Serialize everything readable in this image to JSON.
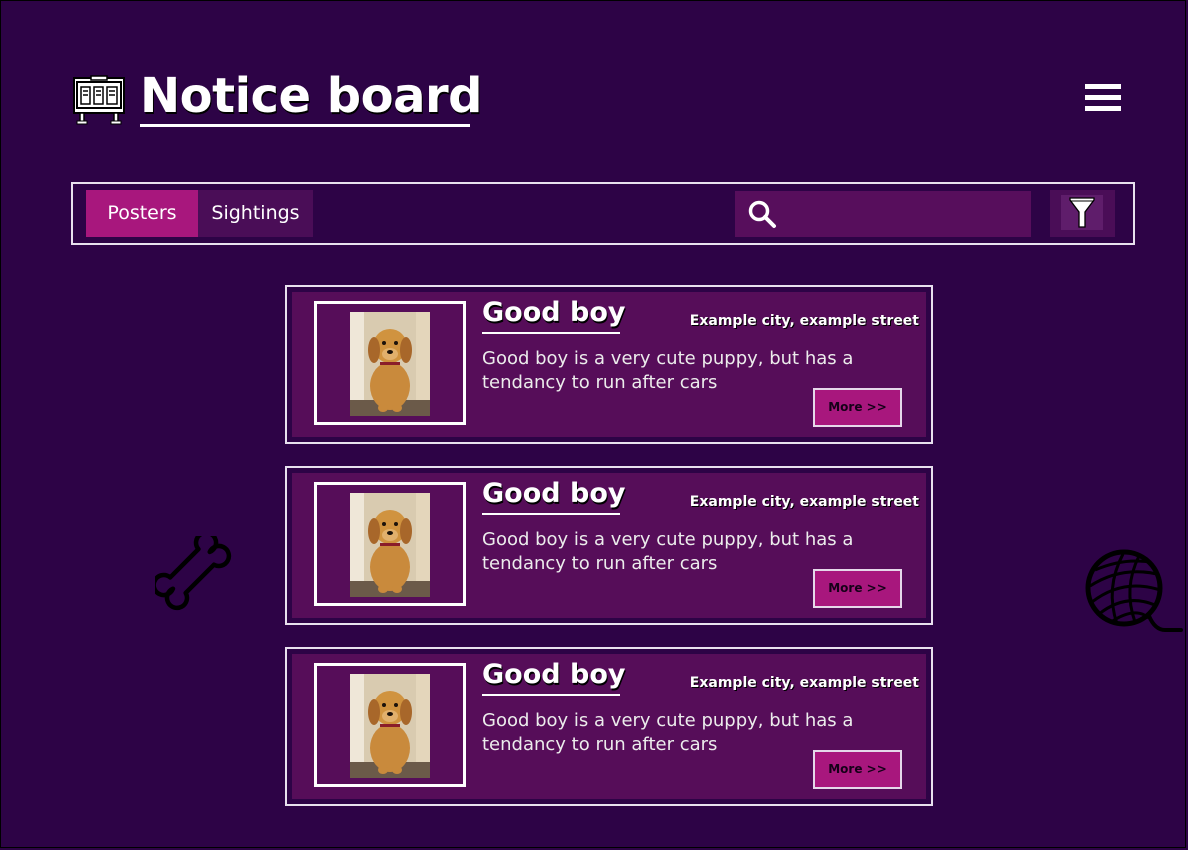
{
  "header": {
    "title": "Notice board",
    "logo_icon": "notice-board-icon",
    "menu_icon": "hamburger-menu-icon"
  },
  "toolbar": {
    "tabs": [
      {
        "label": "Posters",
        "active": true
      },
      {
        "label": "Sightings",
        "active": false
      }
    ],
    "search": {
      "value": "",
      "placeholder": "",
      "icon": "search-icon"
    },
    "filter_icon": "filter-funnel-icon"
  },
  "posters": [
    {
      "title": "Good boy",
      "location": "Example city, example street",
      "description": "Good boy is a very cute puppy, but has a tendancy to run after cars",
      "more_label": "More >>"
    },
    {
      "title": "Good boy",
      "location": "Example city, example street",
      "description": "Good boy is a very cute puppy, but has a tendancy to run after cars",
      "more_label": "More >>"
    },
    {
      "title": "Good boy",
      "location": "Example city, example street",
      "description": "Good boy is a very cute puppy, but has a tendancy to run after cars",
      "more_label": "More >>"
    }
  ],
  "decorations": [
    "bone-icon",
    "yarn-ball-icon"
  ],
  "colors": {
    "background": "#2d0346",
    "card": "#560d59",
    "accent": "#a8177d",
    "tab_inactive": "#4a0d57",
    "search_bg": "#570e5c"
  }
}
